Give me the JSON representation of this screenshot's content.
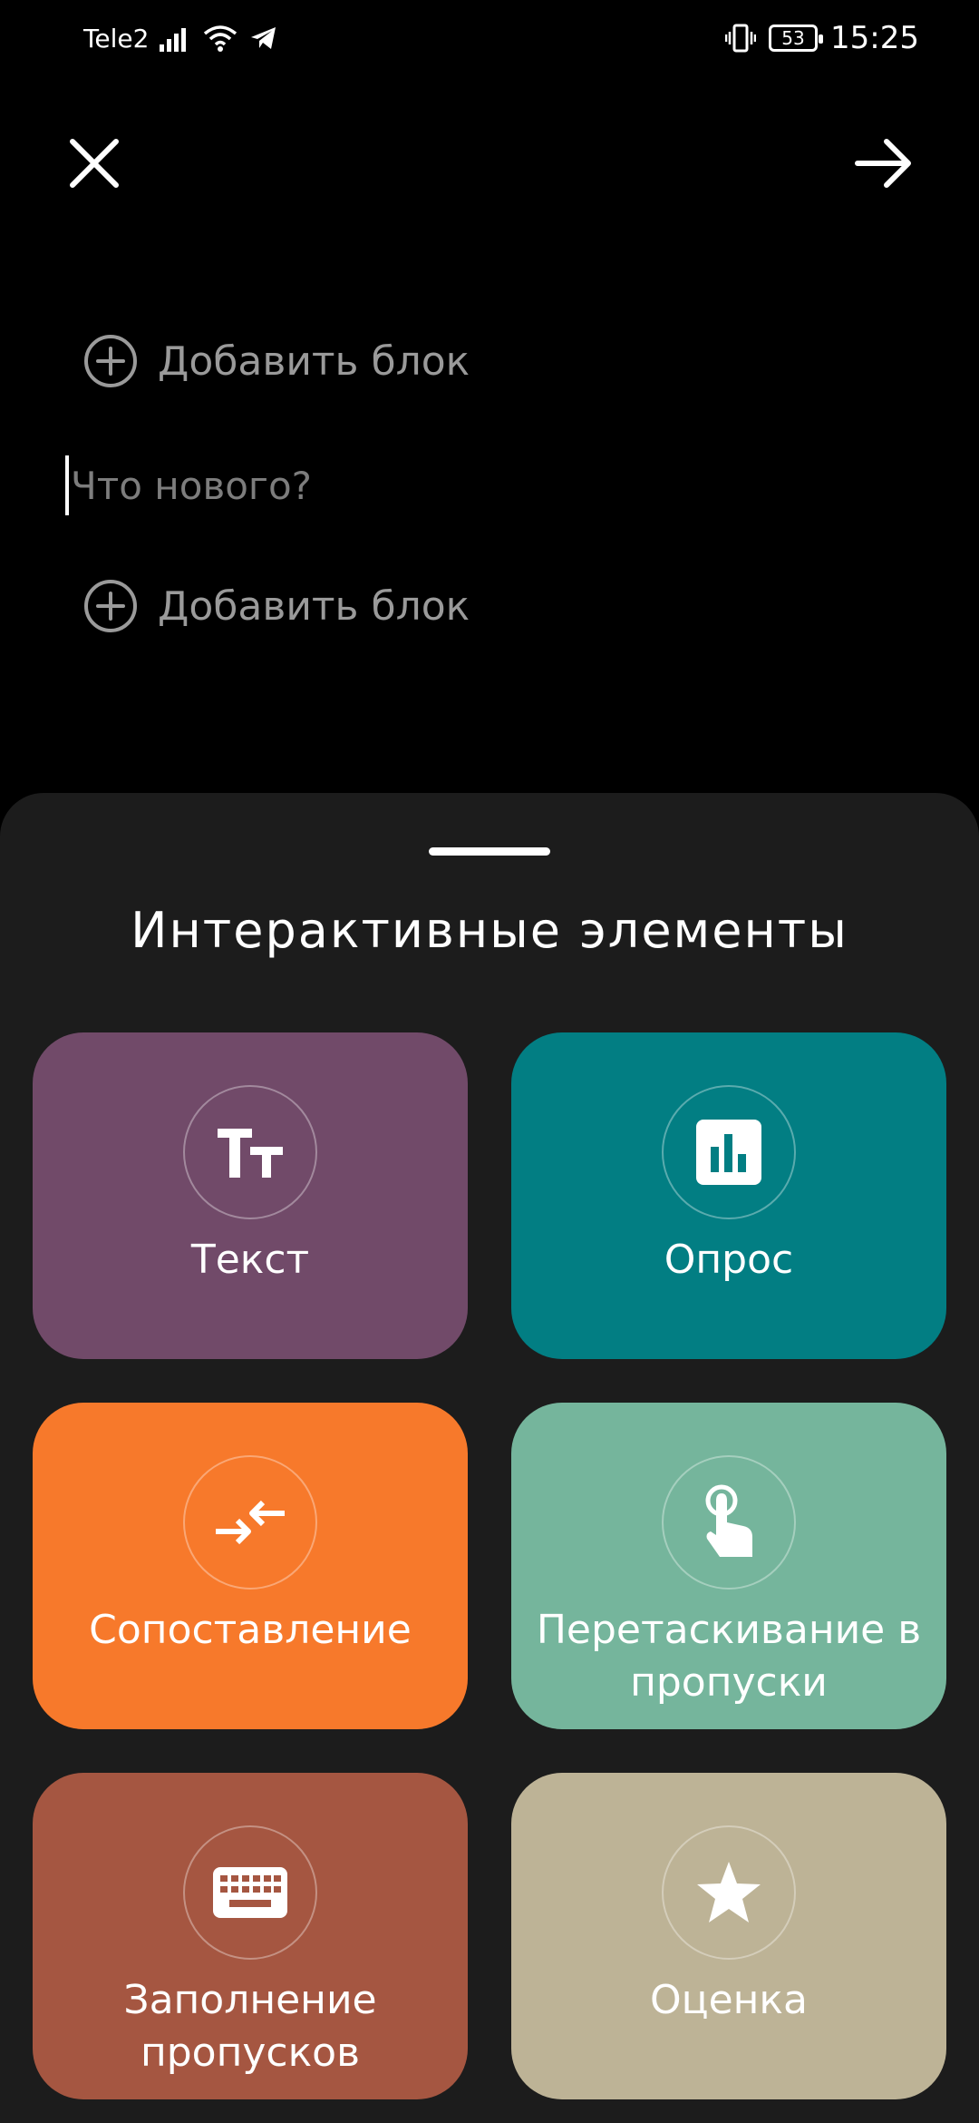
{
  "status_bar": {
    "carrier": "Tele2",
    "battery_level": "53",
    "time": "15:25"
  },
  "editor": {
    "add_block_label": "Добавить блок",
    "input_placeholder": "Что нового?"
  },
  "sheet": {
    "title": "Интерактивные элементы",
    "tiles": [
      {
        "label": "Текст",
        "icon": "text-format-icon",
        "color": "#714a69"
      },
      {
        "label": "Опрос",
        "icon": "poll-chart-icon",
        "color": "#027e83"
      },
      {
        "label": "Сопоставление",
        "icon": "arrows-match-icon",
        "color": "#f7792b"
      },
      {
        "label": "Перетаскивание в пропуски",
        "icon": "touch-drag-icon",
        "color": "#75b59c"
      },
      {
        "label": "Заполнение пропусков",
        "icon": "keyboard-icon",
        "color": "#a55641"
      },
      {
        "label": "Оценка",
        "icon": "star-icon",
        "color": "#bdb396"
      }
    ]
  }
}
